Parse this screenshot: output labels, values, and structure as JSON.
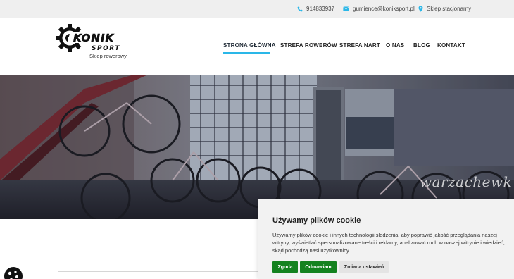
{
  "topbar": {
    "phone": "914833937",
    "email": "gumience@koniksport.pl",
    "shop": "Sklep stacjonarny",
    "icon_phone": "phone-icon",
    "icon_email": "envelope-icon",
    "icon_shop": "map-pin-icon",
    "accent_color": "#2ab7e8"
  },
  "brand": {
    "logo_word": "KONIK",
    "logo_sub_word": "SPORT",
    "tagline": "Sklep rowerowy"
  },
  "nav": {
    "items": [
      {
        "label": "STRONA GŁÓWNA",
        "active": true
      },
      {
        "label": "STREFA ROWERÓW",
        "active": false
      },
      {
        "label": "STREFA NART",
        "active": false
      },
      {
        "label": "O NAS",
        "active": false
      },
      {
        "label": "BLOG",
        "active": false
      },
      {
        "label": "KONTAKT",
        "active": false
      }
    ],
    "active_color": "#2ab7e8"
  },
  "hero": {
    "watermark": "warzachewk"
  },
  "cookie": {
    "title": "Używamy plików cookie",
    "text": "Używamy plików cookie i innych technologii śledzenia, aby poprawić jakość przeglądania naszej witryny, wyświetlać spersonalizowane treści i reklamy, analizować ruch w naszej witrynie i wiedzieć, skąd pochodzą nasi użytkownicy.",
    "agree_label": "Zgoda",
    "reject_label": "Odmawiam",
    "settings_label": "Zmiana ustawień",
    "button_color": "#14821f"
  },
  "cookie_fab_icon": "cookie-icon"
}
